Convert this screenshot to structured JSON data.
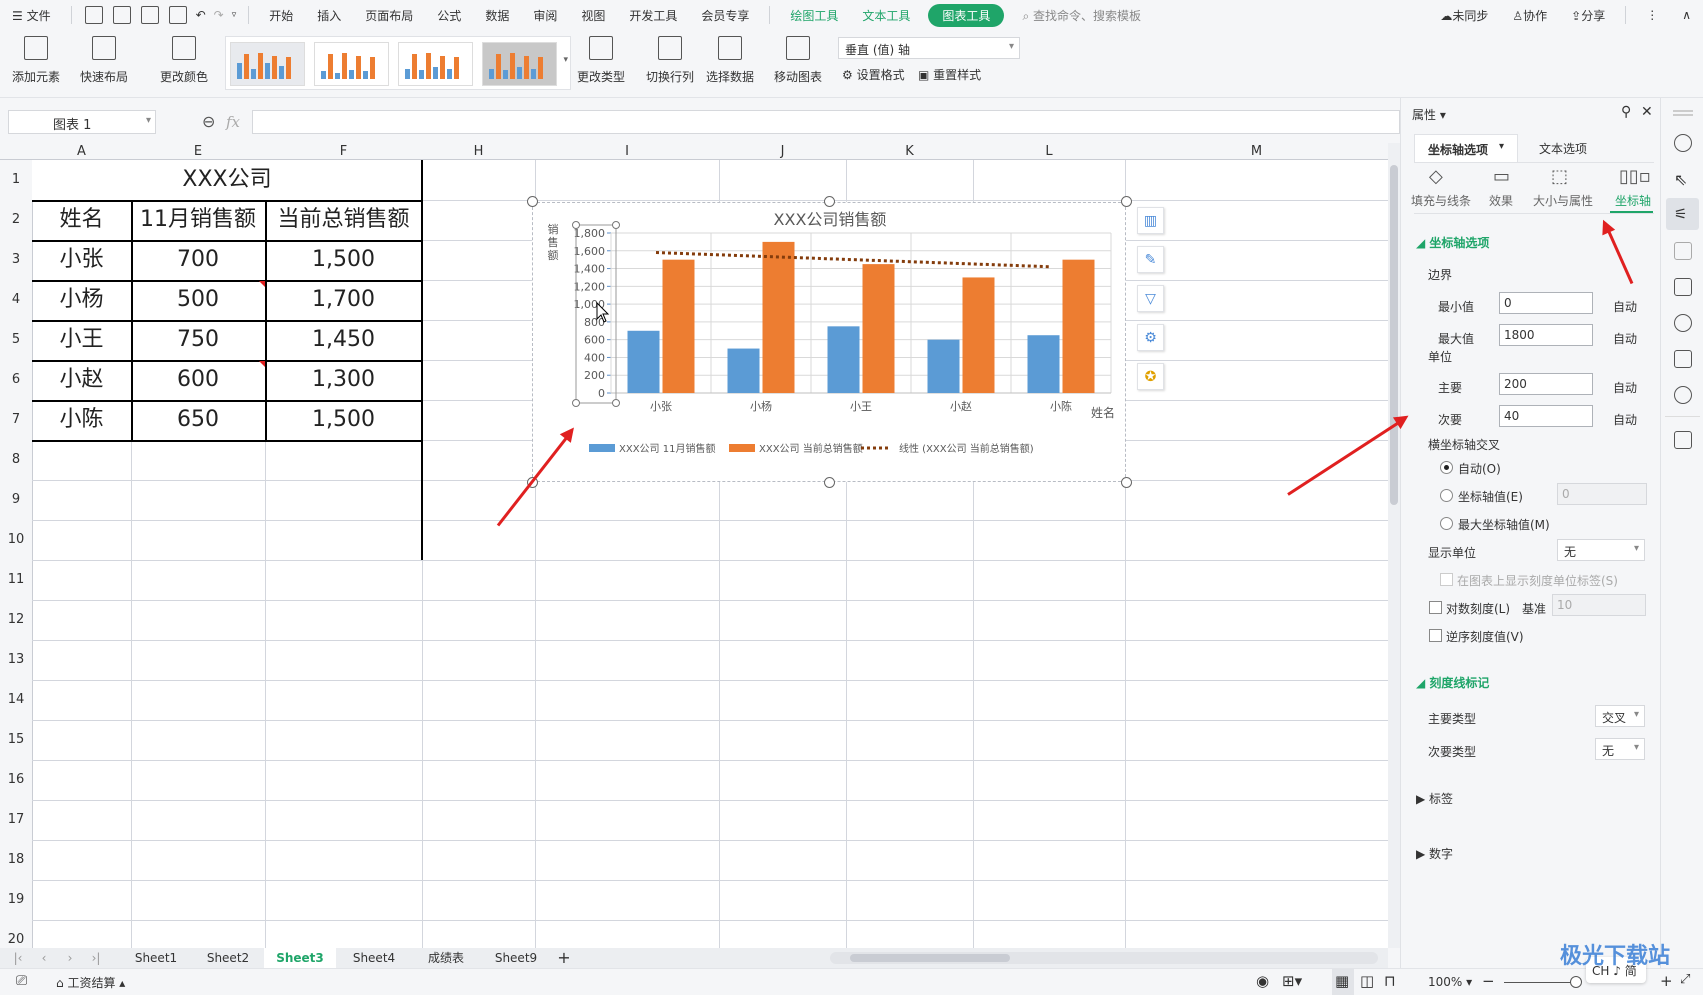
{
  "menubar": {
    "file": "文件",
    "tabs": [
      "开始",
      "插入",
      "页面布局",
      "公式",
      "数据",
      "审阅",
      "视图",
      "开发工具",
      "会员专享"
    ],
    "context_tabs": [
      "绘图工具",
      "文本工具"
    ],
    "active_context_tab": "图表工具",
    "search_placeholder": "查找命令、搜索模板",
    "sync": "未同步",
    "collab": "协作",
    "share": "分享"
  },
  "ribbon": {
    "add_element": "添加元素",
    "quick_layout": "快速布局",
    "change_color": "更改颜色",
    "change_type": "更改类型",
    "switch_row_col": "切换行列",
    "select_data": "选择数据",
    "move_chart": "移动图表",
    "element_select": "垂直 (值) 轴",
    "set_format": "设置格式",
    "reset_style": "重置样式"
  },
  "formula_bar": {
    "name_box": "图表  1",
    "fx": "fx",
    "value": ""
  },
  "columns": [
    "A",
    "E",
    "F",
    "H",
    "I",
    "J",
    "K",
    "L",
    "M"
  ],
  "rows": [
    "1",
    "2",
    "3",
    "4",
    "5",
    "6",
    "7",
    "8",
    "9",
    "10",
    "11",
    "12",
    "13",
    "14",
    "15",
    "16",
    "17",
    "18",
    "19",
    "20"
  ],
  "table": {
    "title": "XXX公司",
    "headers": [
      "姓名",
      "11月销售额",
      "当前总销售额"
    ],
    "rows": [
      [
        "小张",
        "700",
        "1,500"
      ],
      [
        "小杨",
        "500",
        "1,700"
      ],
      [
        "小王",
        "750",
        "1,450"
      ],
      [
        "小赵",
        "600",
        "1,300"
      ],
      [
        "小陈",
        "650",
        "1,500"
      ]
    ]
  },
  "chart_data": {
    "type": "bar",
    "title": "XXX公司销售额",
    "xlabel": "姓名",
    "ylabel": "销售额",
    "categories": [
      "小张",
      "小杨",
      "小王",
      "小赵",
      "小陈"
    ],
    "series": [
      {
        "name": "XXX公司 11月销售额",
        "values": [
          700,
          500,
          750,
          600,
          650
        ],
        "color": "#5b9bd5"
      },
      {
        "name": "XXX公司 当前总销售额",
        "values": [
          1500,
          1700,
          1450,
          1300,
          1500
        ],
        "color": "#ed7d31"
      }
    ],
    "trendline": {
      "name": "线性 (XXX公司 当前总销售额)",
      "start": 1580,
      "end": 1420,
      "color": "#843c0c",
      "style": "dotted"
    },
    "ylim": [
      0,
      1800
    ],
    "yticks": [
      "0",
      "200",
      "400",
      "600",
      "800",
      "1,000",
      "1,200",
      "1,400",
      "1,600",
      "1,800"
    ],
    "grid": true,
    "legend": "bottom"
  },
  "panel": {
    "title": "属性",
    "tabs": [
      "坐标轴选项",
      "文本选项"
    ],
    "subtabs": [
      "填充与线条",
      "效果",
      "大小与属性",
      "坐标轴"
    ],
    "section_axis": "坐标轴选项",
    "bounds_label": "边界",
    "min_label": "最小值",
    "min_value": "0",
    "max_label": "最大值",
    "max_value": "1800",
    "units_label": "单位",
    "major_label": "主要",
    "major_value": "200",
    "minor_label": "次要",
    "minor_value": "40",
    "auto": "自动",
    "cross_label": "横坐标轴交叉",
    "cross_auto": "自动(O)",
    "cross_value": "坐标轴值(E)",
    "cross_value_input": "0",
    "cross_max": "最大坐标轴值(M)",
    "display_units_label": "显示单位",
    "display_units": "无",
    "show_units_label": "在图表上显示刻度单位标签(S)",
    "log_scale": "对数刻度(L)",
    "base_label": "基准",
    "base_value": "10",
    "reverse": "逆序刻度值(V)",
    "section_ticks": "刻度线标记",
    "major_type_label": "主要类型",
    "major_type": "交叉",
    "minor_type_label": "次要类型",
    "minor_type": "无",
    "labels_section": "标签",
    "number_section": "数字"
  },
  "sheets": [
    "Sheet1",
    "Sheet2",
    "Sheet3",
    "Sheet4",
    "成绩表",
    "Sheet9"
  ],
  "active_sheet": "Sheet3",
  "status": {
    "macro": "工资结算",
    "zoom": "100%",
    "ime": "CH ♪ 简"
  },
  "watermark": "极光下载站"
}
